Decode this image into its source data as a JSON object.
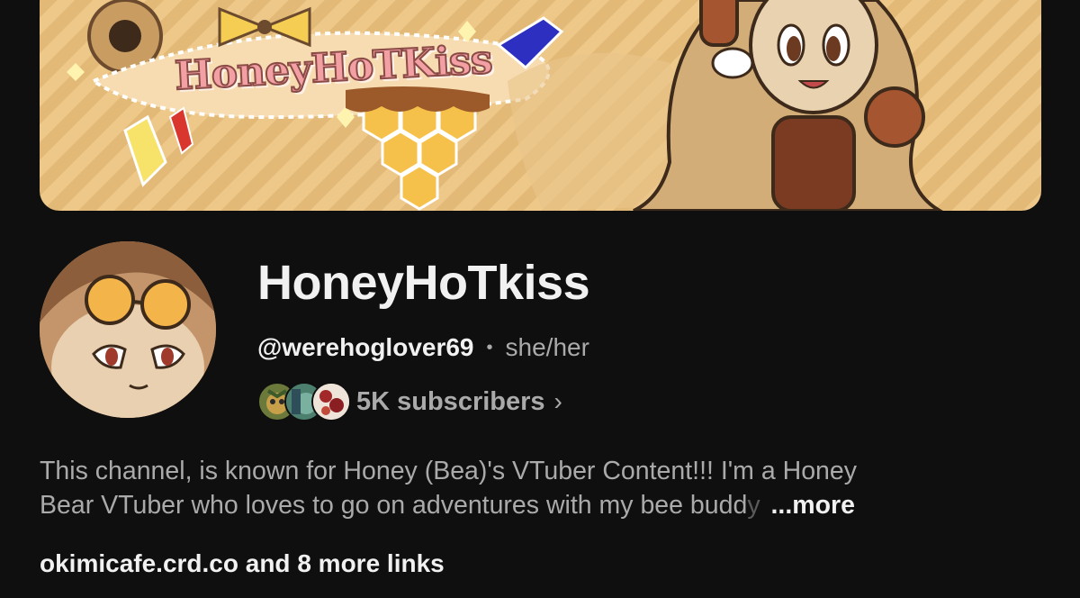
{
  "banner": {
    "logo_text": "HoneyHoTKiss"
  },
  "channel": {
    "name": "HoneyHoTkiss",
    "handle": "@werehoglover69",
    "separator": "•",
    "pronouns": "she/her",
    "subscribers": "5K subscribers",
    "chevron": "›"
  },
  "description": {
    "line1": "This channel, is known for Honey (Bea)'s VTuber Content!!! I'm a Honey",
    "line2_main": "Bear VTuber who loves to go on adventures with my bee budd",
    "line2_faded": "y",
    "more_label": "...more"
  },
  "links": {
    "text": "okimicafe.crd.co and 8 more links"
  },
  "colors": {
    "background": "#0f0f0f",
    "primary_text": "#f1f1f1",
    "secondary_text": "#aaaaaa",
    "banner_honey": "#edc889"
  }
}
